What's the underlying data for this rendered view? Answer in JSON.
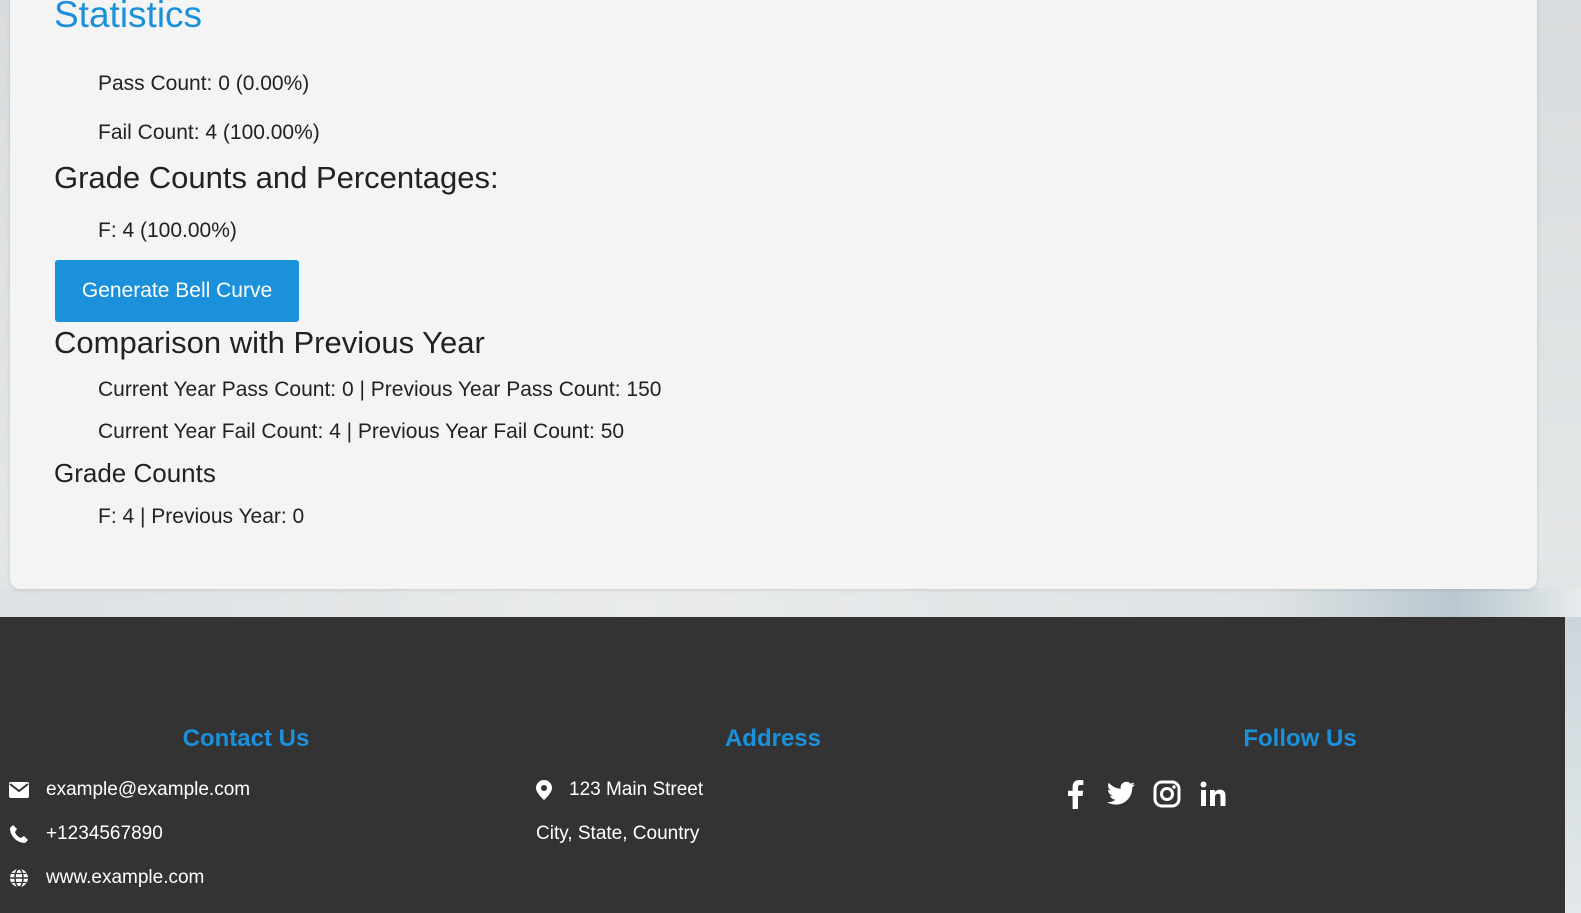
{
  "stats": {
    "title": "Statistics",
    "pass_count": "Pass Count: 0 (0.00%)",
    "fail_count": "Fail Count: 4 (100.00%)",
    "grade_heading": "Grade Counts and Percentages:",
    "grade_f": "F: 4 (100.00%)",
    "bell_button": "Generate Bell Curve",
    "comparison_heading": "Comparison with Previous Year",
    "comparison_pass": "Current Year Pass Count: 0 | Previous Year Pass Count: 150",
    "comparison_fail": "Current Year Fail Count: 4 | Previous Year Fail Count: 50",
    "grade_counts_heading": "Grade Counts",
    "grade_counts_f": "F: 4 | Previous Year: 0"
  },
  "footer": {
    "contact_heading": "Contact Us",
    "email": "example@example.com",
    "phone": "+1234567890",
    "website": "www.example.com",
    "address_heading": "Address",
    "street": "123 Main Street",
    "city": "City, State, Country",
    "follow_heading": "Follow Us",
    "social_icons": [
      "facebook-icon",
      "twitter-icon",
      "instagram-icon",
      "linkedin-icon"
    ]
  },
  "colors": {
    "accent": "#1a91da",
    "footer_bg": "#333333",
    "card_bg": "#f4f4f4"
  }
}
